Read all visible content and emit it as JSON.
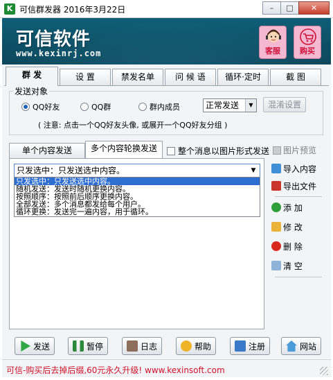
{
  "window": {
    "title": "可信群发器 2016年3月22日",
    "app_icon_letter": "K",
    "minimize": "–",
    "maximize": "□",
    "close": "✕"
  },
  "banner": {
    "title": "可信软件",
    "url": "www.kexinrj.com",
    "service_label": "客服",
    "buy_label": "购买"
  },
  "tabs": [
    "群 发",
    "设 置",
    "禁发名单",
    "问 候 语",
    "循环·定时",
    "截 图"
  ],
  "send_target": {
    "legend": "发送对象",
    "options": [
      "QQ好友",
      "QQ群",
      "群内成员"
    ],
    "selected": "QQ好友",
    "mode_select": "正常发送",
    "mix_button": "混淆设置",
    "note": "( 注意: 点击一个QQ好友头像, 或展开一个QQ好友分组 )"
  },
  "subtabs": {
    "single": "单个内容发送",
    "multi": "多个内容轮换发送",
    "image_mode": "整个消息以图片形式发送",
    "preview": "图片预览"
  },
  "content": {
    "combo_value": "只发选中：只发送选中内容。",
    "dropdown_options": [
      "只发选中：只发送选中内容。",
      "随机发送：发送时随机更换内容。",
      "按照顺序：按照前后顺序更换内容。",
      "全部发送：多个消息都发给每个用户。",
      "循环更换：发送完一遍内容，用于循环。"
    ]
  },
  "side_buttons": {
    "import": "导入内容",
    "export": "导出文件",
    "add": "添 加",
    "edit": "修 改",
    "delete": "删 除",
    "clear": "清 空"
  },
  "bottom_buttons": {
    "send": "发送",
    "pause": "暂停",
    "log": "日志",
    "help": "帮助",
    "register": "注册",
    "website": "网站"
  },
  "status": "可信-购买后去掉后缀,60元永久升级! www.kexinsoft.com"
}
